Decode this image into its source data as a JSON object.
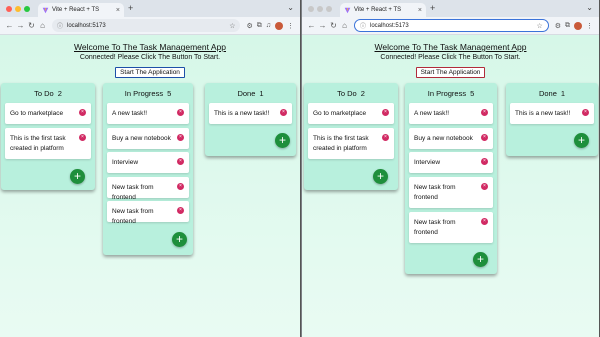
{
  "windows": [
    {
      "id": "left",
      "tab_title": "Vite + React + TS",
      "url": "localhost:5173",
      "app": {
        "title": "Welcome To The Task Management App",
        "subtitle": "Connected! Please Click The Button To Start.",
        "start_button": "Start The Application"
      },
      "columns": [
        {
          "name": "To Do",
          "count": "2",
          "tasks": [
            "Go to marketplace",
            "This is the first task created in platform"
          ]
        },
        {
          "name": "In Progress",
          "count": "5",
          "tasks": [
            "A new task!!",
            "Buy a new notebook",
            "Interview",
            "New task from frontend",
            "New task from frontend"
          ]
        },
        {
          "name": "Done",
          "count": "1",
          "tasks": [
            "This is a new task!!"
          ]
        }
      ]
    },
    {
      "id": "right",
      "tab_title": "Vite + React + TS",
      "url": "localhost:5173",
      "app": {
        "title": "Welcome To The Task Management App",
        "subtitle": "Connected! Please Click The Button To Start.",
        "start_button": "Start The Application"
      },
      "columns": [
        {
          "name": "To Do",
          "count": "2",
          "tasks": [
            "Go to marketplace",
            "This is the first task created in platform"
          ]
        },
        {
          "name": "In Progress",
          "count": "5",
          "tasks": [
            "A new task!!",
            "Buy a new notebook",
            "Interview",
            "New task from frontend",
            "New task from frontend"
          ]
        },
        {
          "name": "Done",
          "count": "1",
          "tasks": [
            "This is a new task!!"
          ]
        }
      ]
    }
  ],
  "icons": {
    "delete": "x-circle-icon",
    "add": "plus-icon",
    "favicon": "vite-icon"
  },
  "colors": {
    "column_bg": "#b8f0dd",
    "add_button": "#1e8f3c",
    "delete_button": "#d12a63"
  }
}
